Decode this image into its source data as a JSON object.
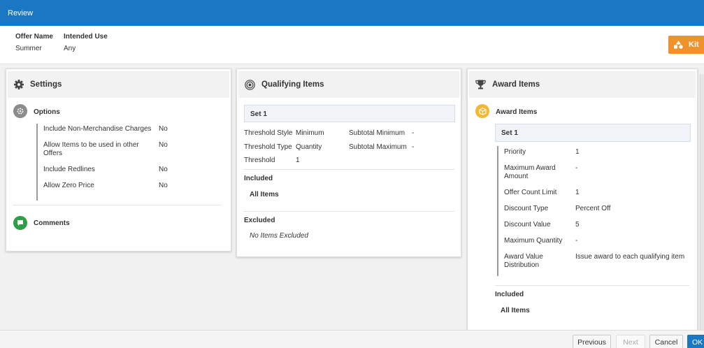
{
  "window": {
    "title": "Review"
  },
  "offer": {
    "name_label": "Offer Name",
    "name_value": "Summer",
    "use_label": "Intended Use",
    "use_value": "Any",
    "kit_label": "Kit"
  },
  "settings": {
    "title": "Settings",
    "options_title": "Options",
    "options": [
      {
        "label": "Include Non-Merchandise Charges",
        "value": "No"
      },
      {
        "label": "Allow Items to be used in other Offers",
        "value": "No"
      },
      {
        "label": "Include Redlines",
        "value": "No"
      },
      {
        "label": "Allow Zero Price",
        "value": "No"
      }
    ],
    "comments_title": "Comments"
  },
  "qualifying": {
    "title": "Qualifying Items",
    "set_label": "Set 1",
    "threshold_style_label": "Threshold Style",
    "threshold_style_value": "Minimum",
    "subtotal_min_label": "Subtotal Minimum",
    "subtotal_min_value": "-",
    "threshold_type_label": "Threshold Type",
    "threshold_type_value": "Quantity",
    "subtotal_max_label": "Subtotal Maximum",
    "subtotal_max_value": "-",
    "threshold_label": "Threshold",
    "threshold_value": "1",
    "included_label": "Included",
    "included_value": "All Items",
    "excluded_label": "Excluded",
    "excluded_value": "No Items Excluded"
  },
  "award": {
    "title": "Award Items",
    "section_title": "Award Items",
    "set_label": "Set 1",
    "rows": [
      {
        "label": "Priority",
        "value": "1"
      },
      {
        "label": "Maximum Award Amount",
        "value": "-"
      },
      {
        "label": "Offer Count Limit",
        "value": "1"
      },
      {
        "label": "Discount Type",
        "value": "Percent Off"
      },
      {
        "label": "Discount Value",
        "value": "5"
      },
      {
        "label": "Maximum Quantity",
        "value": "-"
      },
      {
        "label": "Award Value Distribution",
        "value": "Issue award to each qualifying item"
      }
    ],
    "included_label": "Included",
    "included_value": "All Items"
  },
  "footer": {
    "previous": "Previous",
    "next": "Next",
    "cancel": "Cancel",
    "ok": "OK"
  },
  "colors": {
    "brand_blue": "#1a77c4",
    "kit_orange": "#f0922b",
    "comments_green": "#2e9e47",
    "award_yellow": "#f5b731"
  }
}
